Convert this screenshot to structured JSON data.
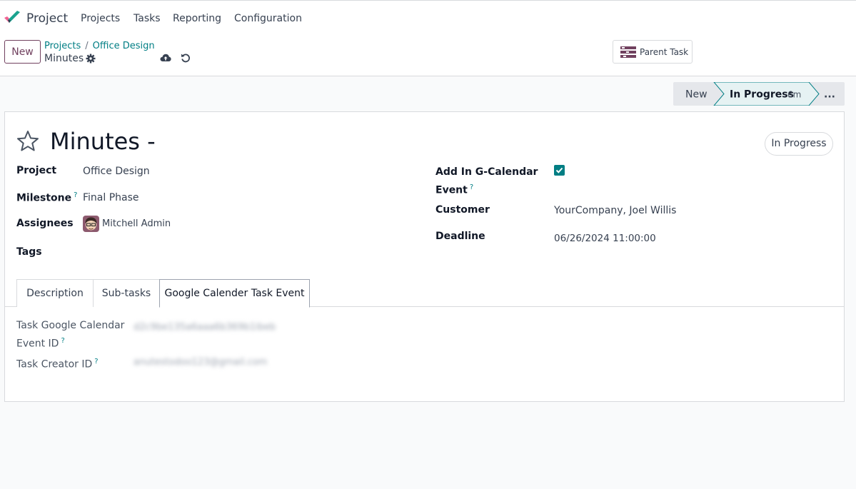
{
  "app": {
    "name": "Project"
  },
  "nav": {
    "items": [
      "Projects",
      "Tasks",
      "Reporting",
      "Configuration"
    ]
  },
  "control": {
    "new_label": "New",
    "breadcrumb": [
      "Projects",
      "Office Design"
    ],
    "breadcrumb_separator": "/",
    "record_name": "Minutes",
    "parent_task_label": "Parent Task"
  },
  "statusbar": {
    "stages": [
      {
        "label": "New",
        "active": false
      },
      {
        "label": "In Progress",
        "duration": "6m",
        "active": true
      }
    ],
    "more_label": "..."
  },
  "task": {
    "title": "Minutes -",
    "state_badge": "In Progress",
    "fields_left": {
      "project_label": "Project",
      "project_value": "Office Design",
      "milestone_label": "Milestone",
      "milestone_value": "Final Phase",
      "assignees_label": "Assignees",
      "assignees_value": "Mitchell Admin",
      "tags_label": "Tags"
    },
    "fields_right": {
      "gcal_label_line1": "Add In G-Calendar",
      "gcal_label_line2": "Event",
      "gcal_checked": true,
      "customer_label": "Customer",
      "customer_value": "YourCompany, Joel Willis",
      "deadline_label": "Deadline",
      "deadline_value": "06/26/2024 11:00:00"
    },
    "help_marker": "?"
  },
  "tabs": [
    {
      "label": "Description",
      "active": false
    },
    {
      "label": "Sub-tasks",
      "active": false
    },
    {
      "label": "Google Calender Task Event",
      "active": true
    }
  ],
  "gcal_tab": {
    "event_id_label_line1": "Task Google Calendar",
    "event_id_label_line2": "Event ID",
    "event_id_value": "d2c9be135a6aaa6b369b1ibeb",
    "creator_label": "Task Creator ID",
    "creator_value": "anutestodoo123@gmail.com"
  },
  "colors": {
    "accent": "#017e84",
    "primary": "#71415f",
    "border": "#d8dadd"
  }
}
